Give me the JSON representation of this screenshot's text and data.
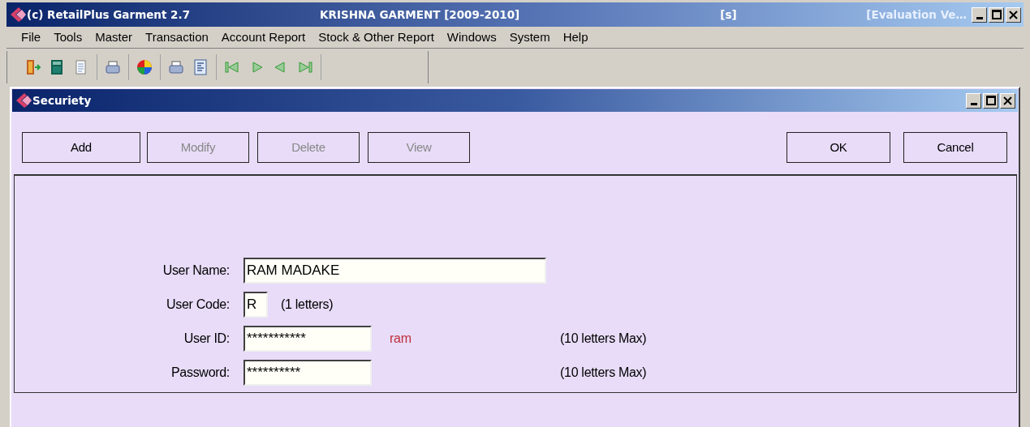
{
  "window": {
    "title": "(c) RetailPlus Garment 2.7",
    "company": "KRISHNA GARMENT [2009-2010]",
    "mode": "[s]",
    "edition": "[Evaluation Ve…"
  },
  "menu": [
    "File",
    "Tools",
    "Master",
    "Transaction",
    "Account Report",
    "Stock & Other Report",
    "Windows",
    "System",
    "Help"
  ],
  "toolbar": [
    [
      {
        "kind": "exit"
      },
      {
        "kind": "calculator"
      },
      {
        "kind": "document"
      }
    ],
    [
      {
        "kind": "printer"
      }
    ],
    [
      {
        "kind": "colors"
      }
    ],
    [
      {
        "kind": "printer"
      },
      {
        "kind": "report"
      }
    ],
    [
      {
        "kind": "first"
      },
      {
        "kind": "next"
      },
      {
        "kind": "previous"
      },
      {
        "kind": "last"
      }
    ]
  ],
  "dialog": {
    "title": "Securiety",
    "buttons": [
      {
        "label": "Add",
        "disabled": false
      },
      {
        "label": "Modify",
        "disabled": true
      },
      {
        "label": "Delete",
        "disabled": true
      },
      {
        "label": "View",
        "disabled": true
      }
    ],
    "actions": [
      {
        "label": "OK",
        "disabled": false
      },
      {
        "label": "Cancel",
        "disabled": false
      }
    ],
    "fields": [
      {
        "kind": "wide",
        "label": "User Name:",
        "value": "RAM MADAKE"
      },
      {
        "kind": "code",
        "label": "User Code:",
        "value": "R",
        "hint": "(1 letters)"
      },
      {
        "kind": "short",
        "label": "User ID:",
        "value": "***********",
        "note": "ram",
        "limit": "(10 letters Max)"
      },
      {
        "kind": "short",
        "label": "Password:",
        "value": "**********",
        "limit": "(10 letters Max)"
      }
    ]
  }
}
